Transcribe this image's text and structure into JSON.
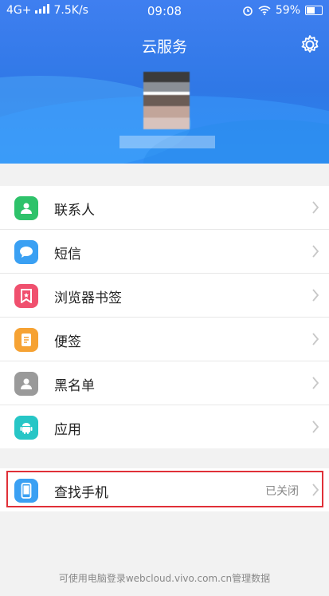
{
  "status_bar": {
    "network": "4G+",
    "speed": "7.5K/s",
    "time": "09:08",
    "battery": "59%"
  },
  "header": {
    "title": "云服务"
  },
  "menu": [
    {
      "label": "联系人",
      "icon": "contacts-icon",
      "color": "#2ec26a"
    },
    {
      "label": "短信",
      "icon": "message-icon",
      "color": "#3aa0f3"
    },
    {
      "label": "浏览器书签",
      "icon": "bookmark-icon",
      "color": "#f0506e"
    },
    {
      "label": "便签",
      "icon": "note-icon",
      "color": "#f6a233"
    },
    {
      "label": "黑名单",
      "icon": "blacklist-icon",
      "color": "#9a9a9a"
    },
    {
      "label": "应用",
      "icon": "android-icon",
      "color": "#27c6c6"
    }
  ],
  "find_phone": {
    "label": "查找手机",
    "status": "已关闭",
    "icon": "phone-icon",
    "color": "#3aa0f3",
    "highlight_color": "#e03038"
  },
  "footer": "可使用电脑登录webcloud.vivo.com.cn管理数据"
}
